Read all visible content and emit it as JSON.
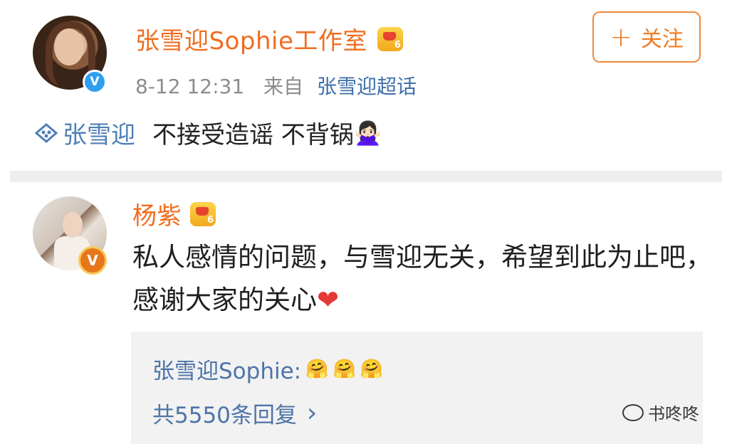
{
  "post": {
    "author": "张雪迎Sophie工作室",
    "crown_level": "6",
    "verified_badge": "V",
    "timestamp": "8-12 12:31",
    "source_prefix": "来自",
    "source_link": "张雪迎超话",
    "follow_label": "关注",
    "follow_icon": "+",
    "topic_icon": "super-topic-icon",
    "topic": "张雪迎",
    "text": "不接受造谣 不背锅",
    "text_emoji": "🙅🏻‍♀"
  },
  "comment": {
    "author": "杨紫",
    "crown_level": "6",
    "verified_badge": "V",
    "text": "私人感情的问题，与雪迎无关，希望到此为止吧，感谢大家的关心",
    "text_emoji": "❤",
    "reply": {
      "author": "张雪迎Sophie:",
      "emojis": [
        "🤗",
        "🤗",
        "🤗"
      ],
      "total_label": "共5550条回复",
      "chevron": "›"
    }
  },
  "watermark": {
    "text": "书咚咚",
    "icon": "wechat-icon"
  },
  "colors": {
    "username": "#f06d1f",
    "link": "#3d6eab",
    "meta": "#8c8c8c",
    "verified_blue": "#2f9ff0",
    "verified_orange": "#e6761b",
    "reply_bg": "#f2f2f2"
  }
}
